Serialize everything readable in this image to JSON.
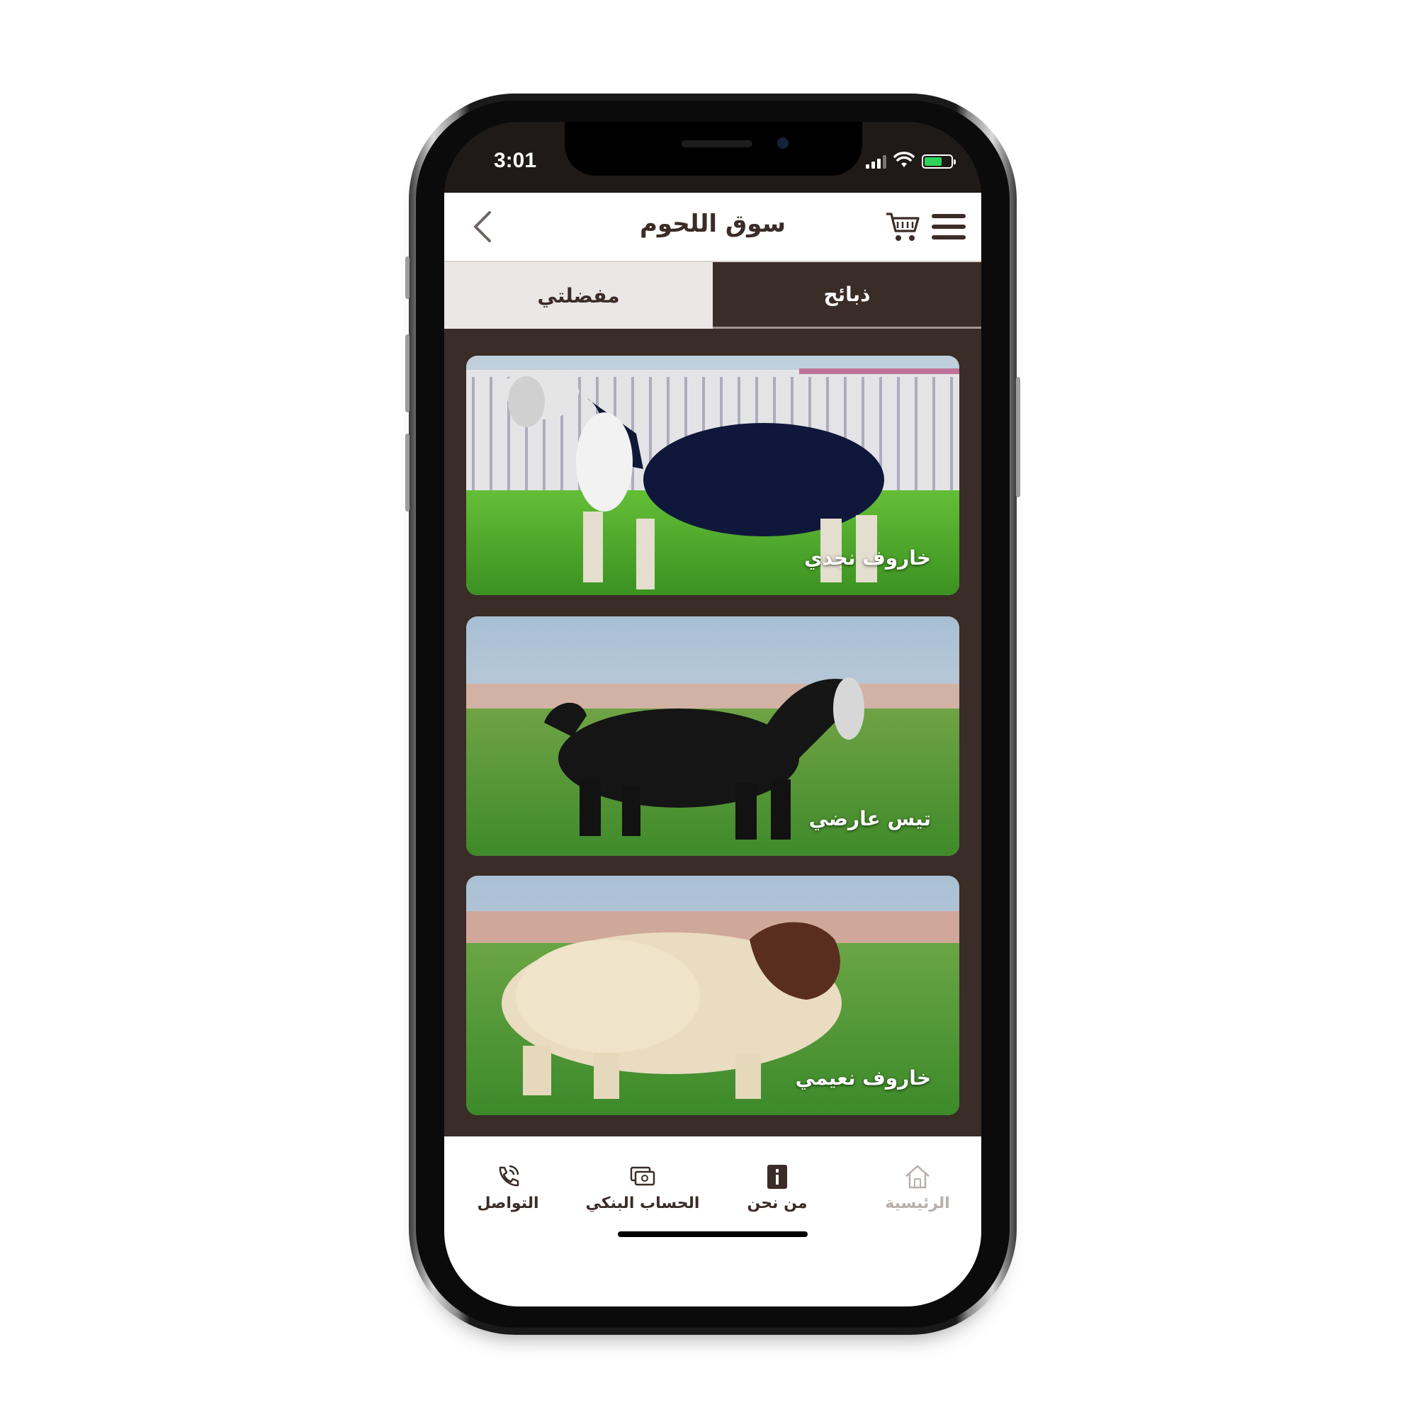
{
  "status_bar": {
    "time": "3:01"
  },
  "header": {
    "title": "سوق اللحوم"
  },
  "tabs": [
    {
      "label": "مفضلتي",
      "active": false
    },
    {
      "label": "ذبائح",
      "active": true
    }
  ],
  "cards": [
    {
      "label": "خاروف نجدي"
    },
    {
      "label": "تيس عارضي"
    },
    {
      "label": "خاروف نعيمي"
    }
  ],
  "bottom_nav": [
    {
      "label": "التواصل",
      "icon": "phone-icon"
    },
    {
      "label": "الحساب البنكي",
      "icon": "bank-card-icon"
    },
    {
      "label": "من نحن",
      "icon": "info-icon"
    },
    {
      "label": "الرئيسية",
      "icon": "home-icon"
    }
  ],
  "colors": {
    "brand": "#3a2c27",
    "tab_inactive": "#ebe7e6",
    "battery": "#2fd158"
  }
}
